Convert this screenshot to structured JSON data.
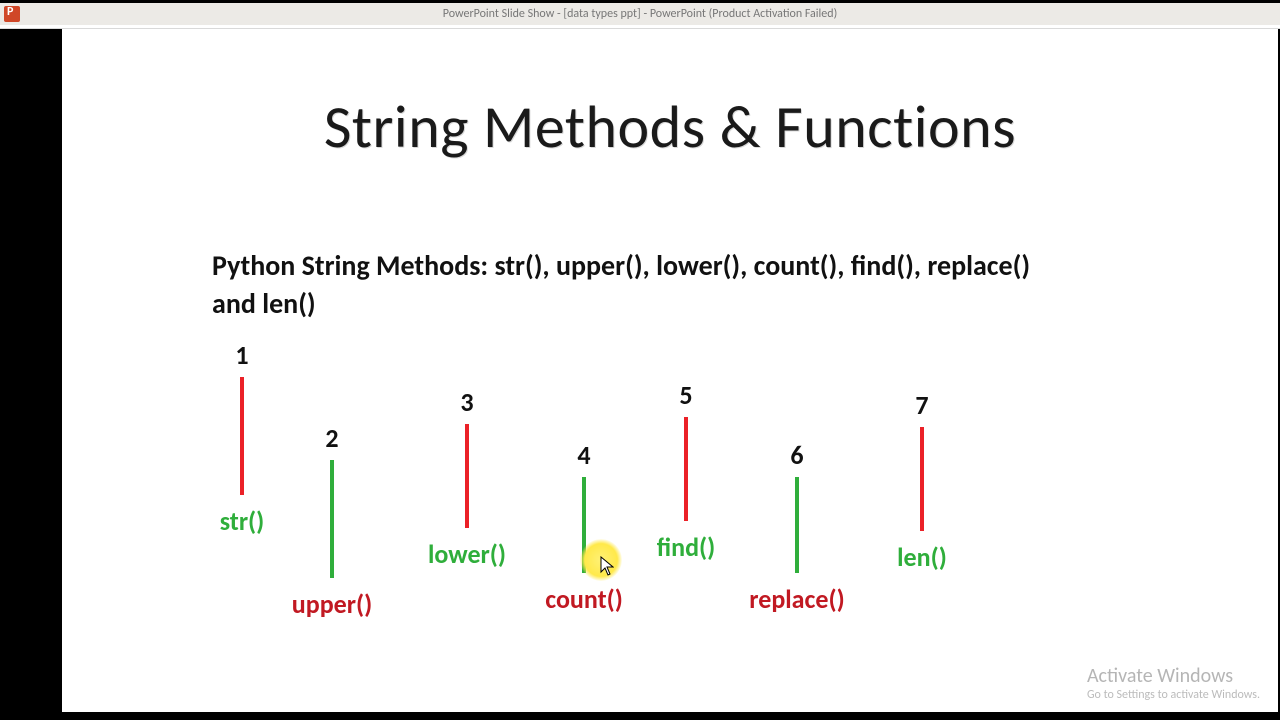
{
  "window": {
    "title": "PowerPoint Slide Show - [data types ppt] - PowerPoint (Product Activation Failed)"
  },
  "slide": {
    "title": "String Methods & Functions",
    "subheading": "Python String Methods: str(), upper(), lower(), count(), find(), replace() and len()",
    "items": [
      {
        "n": "1",
        "label": "str()",
        "labelColor": "green",
        "barColor": "red",
        "barClass": "h1"
      },
      {
        "n": "2",
        "label": "upper()",
        "labelColor": "red",
        "barColor": "green",
        "barClass": "h1"
      },
      {
        "n": "3",
        "label": "lower()",
        "labelColor": "green",
        "barColor": "red",
        "barClass": "h2"
      },
      {
        "n": "4",
        "label": "count()",
        "labelColor": "red",
        "barColor": "green",
        "barClass": "h3"
      },
      {
        "n": "5",
        "label": "find()",
        "labelColor": "green",
        "barColor": "red",
        "barClass": "h2"
      },
      {
        "n": "6",
        "label": "replace()",
        "labelColor": "red",
        "barColor": "green",
        "barClass": "h3"
      },
      {
        "n": "7",
        "label": "len()",
        "labelColor": "green",
        "barColor": "red",
        "barClass": "h2"
      }
    ]
  },
  "watermark": {
    "line1": "Activate Windows",
    "line2": "Go to Settings to activate Windows."
  }
}
